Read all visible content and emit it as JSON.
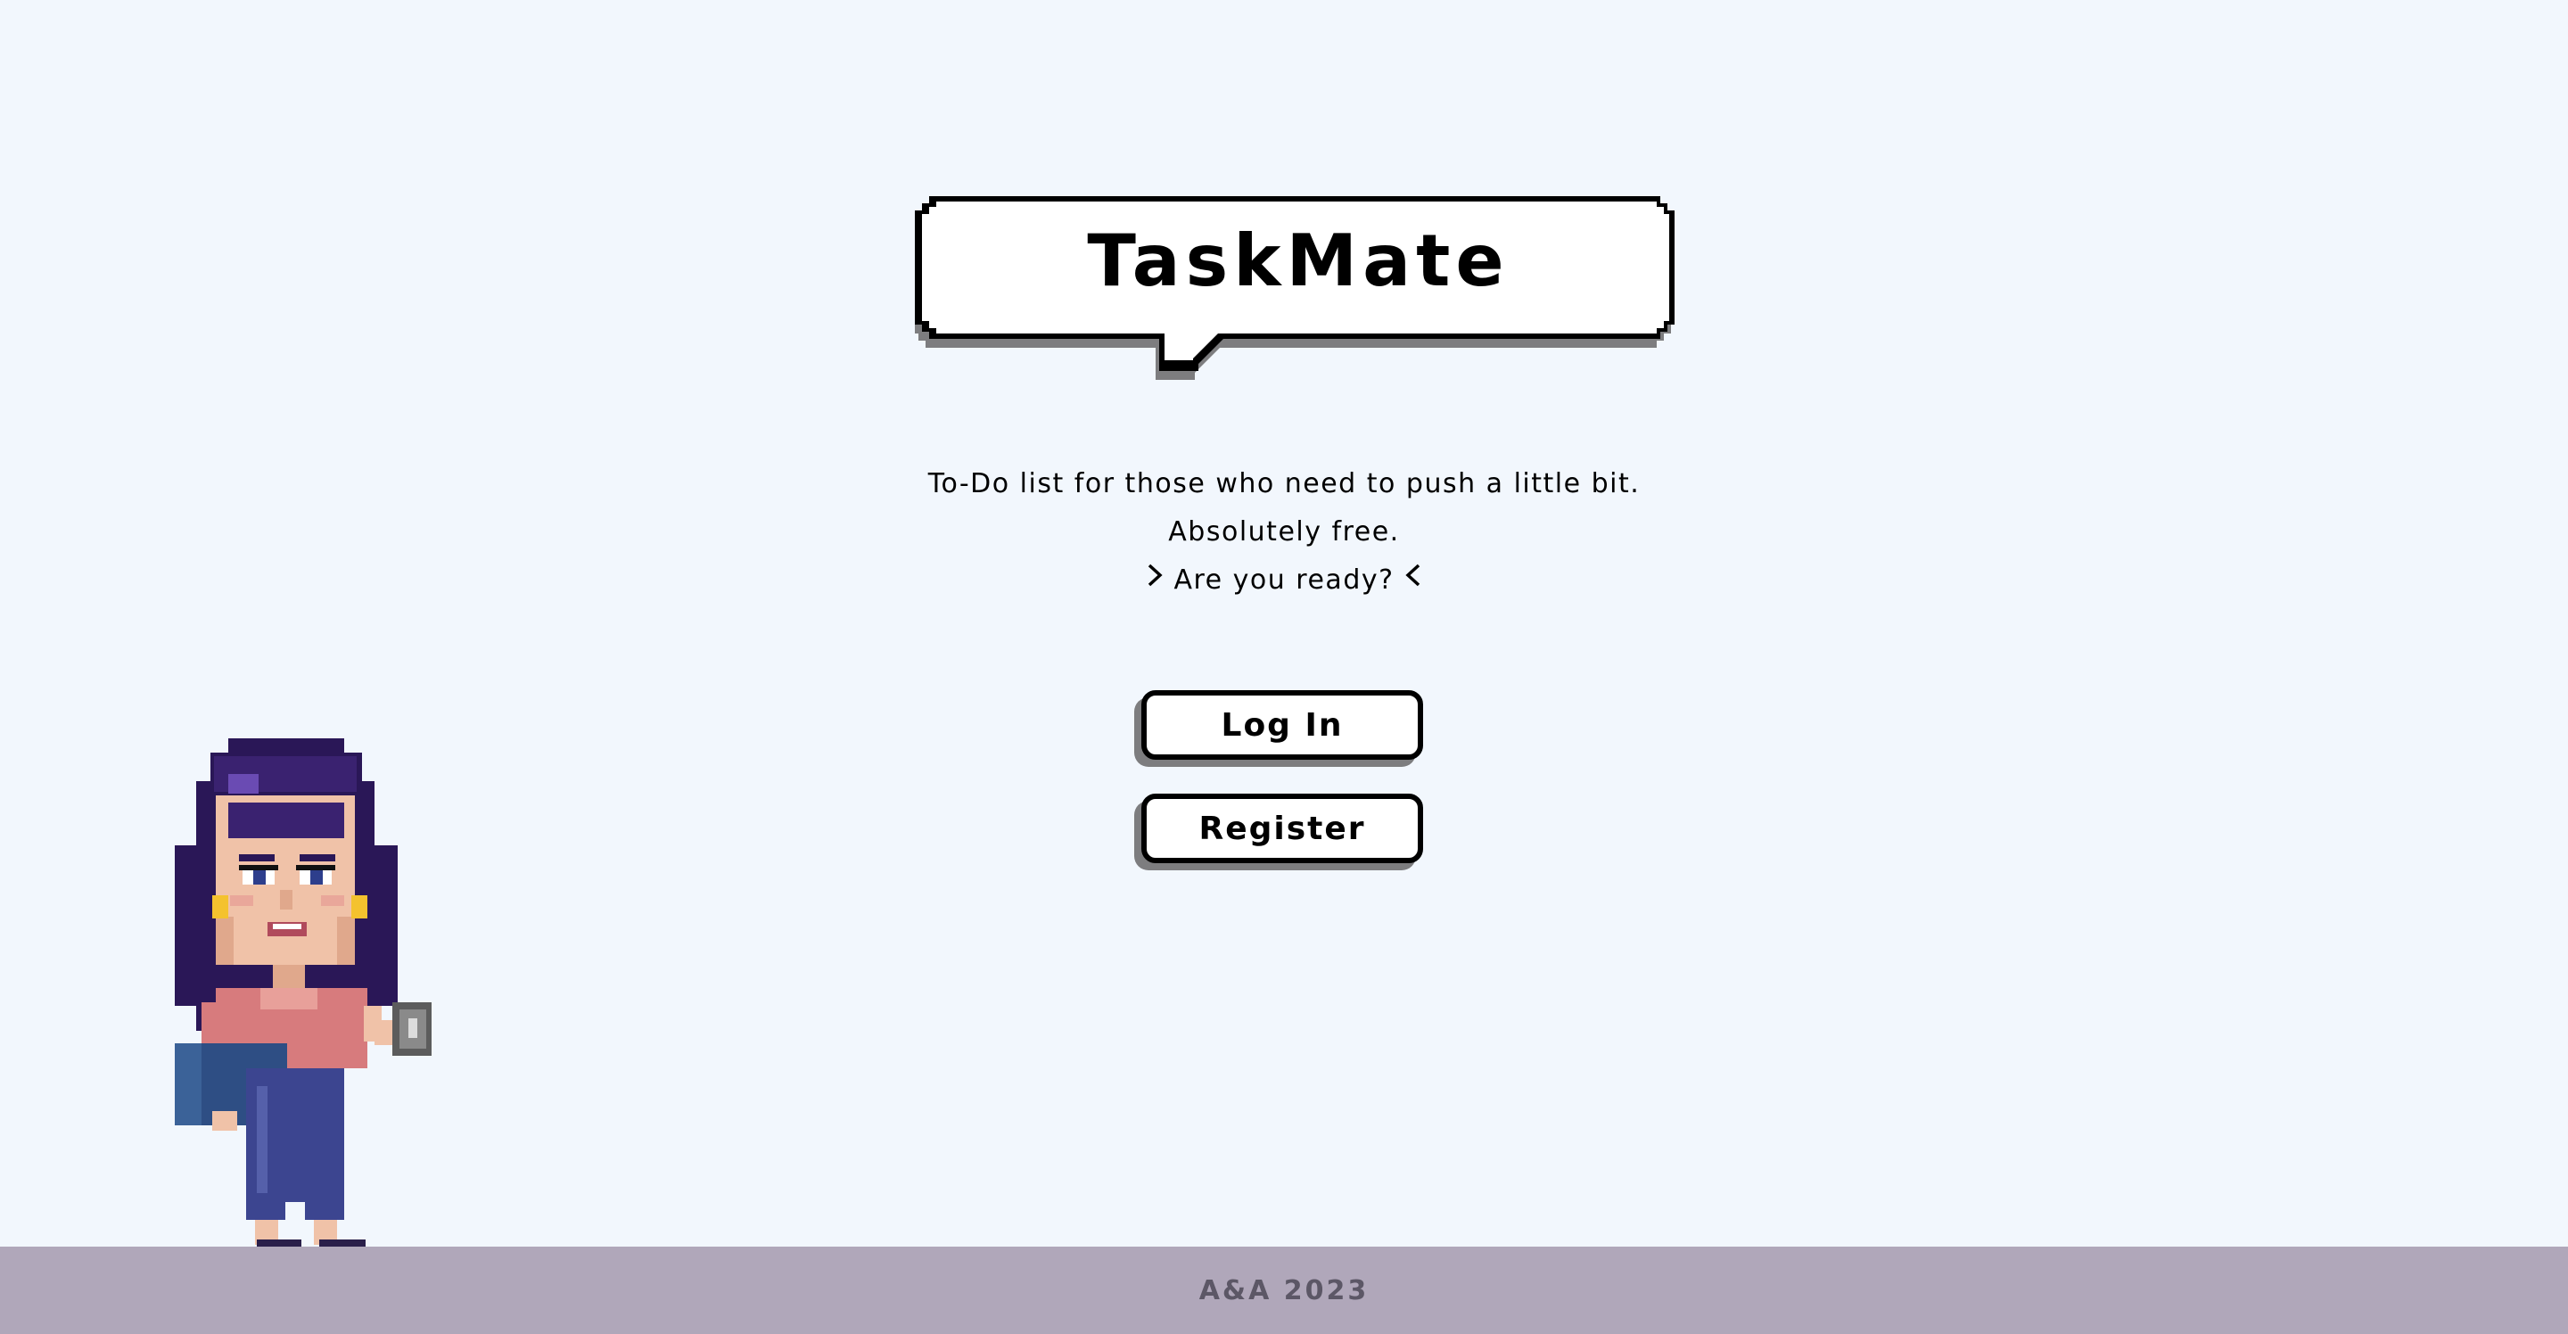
{
  "app": {
    "title": "TaskMate"
  },
  "tagline": {
    "line1": "To-Do list for those who need to push a little bit.",
    "line2": "Absolutely free.",
    "line3": "Are you ready?"
  },
  "buttons": {
    "login_label": "Log In",
    "register_label": "Register"
  },
  "footer": {
    "text": "A&A 2023"
  },
  "icons": {
    "bubble": "speech-bubble-icon",
    "chevron_right": "chevron-right-icon",
    "chevron_left": "chevron-left-icon",
    "character": "pixel-girl-with-mug-illustration"
  },
  "colors": {
    "background": "#f2f7fd",
    "footer": "#b0a7ba",
    "footer_text": "#5c5766",
    "button_shadow": "#7d7d7f",
    "hair": "#3a2270",
    "shirt": "#d77b7d",
    "pants": "#3c4590"
  }
}
